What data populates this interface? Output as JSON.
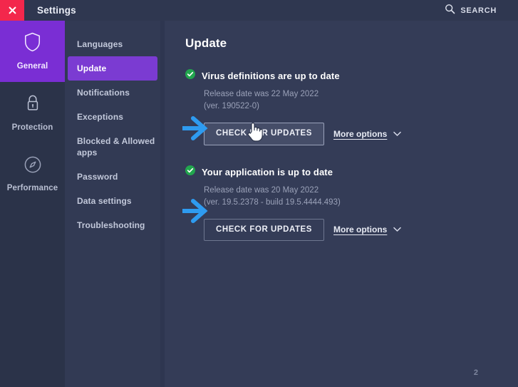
{
  "titlebar": {
    "close_icon": "close-icon",
    "title": "Settings",
    "search_icon": "search-icon",
    "search_label": "SEARCH"
  },
  "rail": {
    "items": [
      {
        "label": "General",
        "icon": "shield-icon",
        "active": true
      },
      {
        "label": "Protection",
        "icon": "lock-icon",
        "active": false
      },
      {
        "label": "Performance",
        "icon": "speedometer-icon",
        "active": false
      }
    ]
  },
  "subnav": {
    "items": [
      {
        "label": "Languages",
        "active": false
      },
      {
        "label": "Update",
        "active": true
      },
      {
        "label": "Notifications",
        "active": false
      },
      {
        "label": "Exceptions",
        "active": false
      },
      {
        "label": "Blocked & Allowed apps",
        "active": false
      },
      {
        "label": "Password",
        "active": false
      },
      {
        "label": "Data settings",
        "active": false
      },
      {
        "label": "Troubleshooting",
        "active": false
      }
    ]
  },
  "content": {
    "page_title": "Update",
    "sections": [
      {
        "status_icon": "check-circle-icon",
        "status_title": "Virus definitions are up to date",
        "release_line": "Release date was 22 May 2022",
        "version_line": "(ver. 190522-0)",
        "button_label": "CHECK FOR UPDATES",
        "more_options_label": "More options",
        "chevron_icon": "chevron-down-icon"
      },
      {
        "status_icon": "check-circle-icon",
        "status_title": "Your application is up to date",
        "release_line": "Release date was 20 May 2022",
        "version_line": "(ver. 19.5.2378 - build 19.5.4444.493)",
        "button_label": "CHECK FOR UPDATES",
        "more_options_label": "More options",
        "chevron_icon": "chevron-down-icon"
      }
    ],
    "page_number": "2"
  },
  "annotations": {
    "arrow_1": "arrow-right-annotation",
    "arrow_2": "arrow-right-annotation",
    "cursor": "hand-pointer-cursor"
  },
  "colors": {
    "accent_purple": "#7a2ed4",
    "nav_active_purple": "#7b3bd2",
    "close_red": "#f3274c",
    "status_green": "#22a64e",
    "annotation_blue": "#2e9bf0",
    "window_bg": "#2e3650",
    "content_bg": "#343c57"
  }
}
